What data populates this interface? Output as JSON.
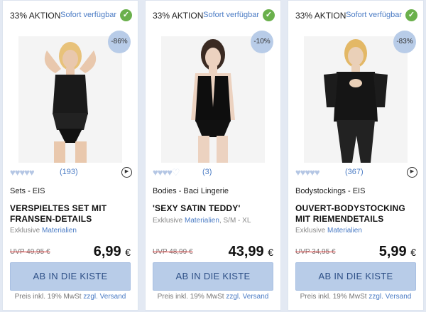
{
  "colors": {
    "accent": "#4a7bc4",
    "button_bg": "#b8cce8",
    "check_green": "#6ab04c"
  },
  "products": [
    {
      "promo": "33% AKTION",
      "availability": "Sofort verfügbar",
      "discount": "-86%",
      "rating_filled": 5,
      "rating_count": "(193)",
      "category": "Sets - EIS",
      "title": "VERSPIELTES SET MIT FRANSEN-DETAILS",
      "subtitle_prefix": "Exklusive ",
      "subtitle_link": "Materialien",
      "subtitle_suffix": "",
      "uvp": "UVP 49,95 €",
      "price": "6,99",
      "currency": "€",
      "cta": "AB IN DIE KISTE",
      "footer_prefix": "Preis inkl. 19% MwSt ",
      "footer_link1": "zzgl.",
      "footer_link2": "Versand",
      "image_icon": "lingerie-set-photo"
    },
    {
      "promo": "33% AKTION",
      "availability": "Sofort verfügbar",
      "discount": "-10%",
      "rating_filled": 4,
      "rating_count": "(3)",
      "category": "Bodies - Baci Lingerie",
      "title": "'SEXY SATIN TEDDY'",
      "subtitle_prefix": "Exklusive ",
      "subtitle_link": "Materialien",
      "subtitle_suffix": ", S/M - XL",
      "uvp": "UVP 48,99 €",
      "price": "43,99",
      "currency": "€",
      "cta": "AB IN DIE KISTE",
      "footer_prefix": "Preis inkl. 19% MwSt ",
      "footer_link1": "zzgl.",
      "footer_link2": "Versand",
      "image_icon": "satin-teddy-photo"
    },
    {
      "promo": "33% AKTION",
      "availability": "Sofort verfügbar",
      "discount": "-83%",
      "rating_filled": 5,
      "rating_count": "(367)",
      "category": "Bodystockings - EIS",
      "title": "OUVERT-BODYSTOCKING MIT RIEMENDETAILS",
      "subtitle_prefix": "Exklusive ",
      "subtitle_link": "Materialien",
      "subtitle_suffix": "",
      "uvp": "UVP 34,95 €",
      "price": "5,99",
      "currency": "€",
      "cta": "AB IN DIE KISTE",
      "footer_prefix": "Preis inkl. 19% MwSt ",
      "footer_link1": "zzgl.",
      "footer_link2": "Versand",
      "image_icon": "bodystocking-photo"
    }
  ]
}
